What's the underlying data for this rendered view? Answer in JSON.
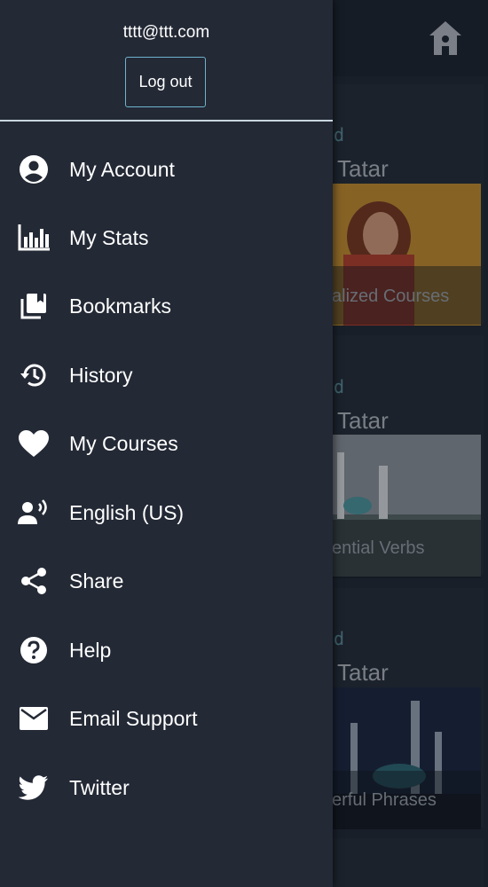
{
  "drawer": {
    "email": "tttt@ttt.com",
    "logout_label": "Log out",
    "items": [
      {
        "label": "My Account",
        "icon": "account-icon"
      },
      {
        "label": "My Stats",
        "icon": "stats-icon"
      },
      {
        "label": "Bookmarks",
        "icon": "bookmarks-icon"
      },
      {
        "label": "History",
        "icon": "history-icon"
      },
      {
        "label": "My Courses",
        "icon": "heart-icon"
      },
      {
        "label": "English (US)",
        "icon": "voice-language-icon"
      },
      {
        "label": "Share",
        "icon": "share-icon"
      },
      {
        "label": "Help",
        "icon": "help-icon"
      },
      {
        "label": "Email Support",
        "icon": "email-icon"
      },
      {
        "label": "Twitter",
        "icon": "twitter-icon"
      }
    ]
  },
  "background": {
    "cards": [
      {
        "subtitle": "d",
        "title": "Tatar",
        "caption": "alized Courses"
      },
      {
        "subtitle": "d",
        "title": "Tatar",
        "caption": "ential Verbs"
      },
      {
        "subtitle": "d",
        "title": "Tatar",
        "caption": "erful Phrases"
      }
    ]
  },
  "colors": {
    "drawer_bg": "#232935",
    "accent_border": "#6fb3cf",
    "text": "#ffffff"
  }
}
